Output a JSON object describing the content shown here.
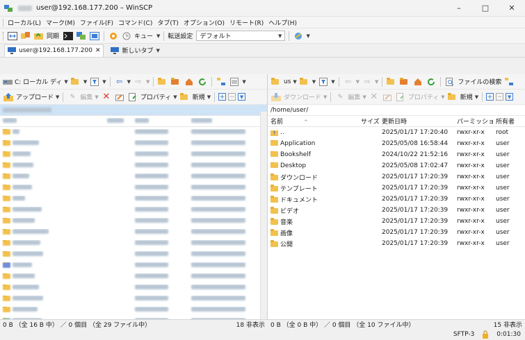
{
  "window": {
    "title": "user@192.168.177.200 – WinSCP",
    "minimize": "–",
    "maximize": "□",
    "close": "✕"
  },
  "menu": [
    "ローカル(L)",
    "マーク(M)",
    "ファイル(F)",
    "コマンド(C)",
    "タブ(T)",
    "オプション(O)",
    "リモート(R)",
    "ヘルプ(H)"
  ],
  "toolbar": {
    "sync": "同期",
    "queue": "キュー",
    "transfer_label": "転送設定",
    "transfer_value": "デフォルト"
  },
  "tabs": {
    "session": "user@192.168.177.200",
    "new_tab": "新しいタブ"
  },
  "left_pane": {
    "drive": "C: ローカル ディ",
    "upload": "アップロード",
    "edit": "編集",
    "properties": "プロパティ",
    "new": "新規",
    "status_left": "0 B （全 16 B 中） ／ 0 個目 （全 29 ファイル中）",
    "status_right": "18 非表示"
  },
  "right_pane": {
    "drive": "us",
    "search": "ファイルの検索",
    "download": "ダウンロード",
    "edit": "編集",
    "properties": "プロパティ",
    "new": "新規",
    "path": "/home/user/",
    "columns": {
      "name": "名前",
      "size": "サイズ",
      "date": "更新日時",
      "perm": "パーミッショ...",
      "owner": "所有者"
    },
    "rows": [
      {
        "name": "..",
        "date": "2025/01/17 17:20:40",
        "perm": "rwxr-xr-x",
        "owner": "root"
      },
      {
        "name": "Application",
        "date": "2025/05/08 16:58:44",
        "perm": "rwxr-xr-x",
        "owner": "user"
      },
      {
        "name": "Bookshelf",
        "date": "2024/10/22 21:52:16",
        "perm": "rwxr-xr-x",
        "owner": "user"
      },
      {
        "name": "Desktop",
        "date": "2025/05/08 17:02:47",
        "perm": "rwxr-xr-x",
        "owner": "user"
      },
      {
        "name": "ダウンロード",
        "date": "2025/01/17 17:20:39",
        "perm": "rwxr-xr-x",
        "owner": "user"
      },
      {
        "name": "テンプレート",
        "date": "2025/01/17 17:20:39",
        "perm": "rwxr-xr-x",
        "owner": "user"
      },
      {
        "name": "ドキュメント",
        "date": "2025/01/17 17:20:39",
        "perm": "rwxr-xr-x",
        "owner": "user"
      },
      {
        "name": "ビデオ",
        "date": "2025/01/17 17:20:39",
        "perm": "rwxr-xr-x",
        "owner": "user"
      },
      {
        "name": "音楽",
        "date": "2025/01/17 17:20:39",
        "perm": "rwxr-xr-x",
        "owner": "user"
      },
      {
        "name": "画像",
        "date": "2025/01/17 17:20:39",
        "perm": "rwxr-xr-x",
        "owner": "user"
      },
      {
        "name": "公開",
        "date": "2025/01/17 17:20:39",
        "perm": "rwxr-xr-x",
        "owner": "user"
      }
    ],
    "status_left": "0 B （全 0 B 中） ／ 0 個目 （全 10 ファイル中）",
    "status_right": "15 非表示"
  },
  "bottom": {
    "protocol": "SFTP-3",
    "timer": "0:01:30"
  }
}
